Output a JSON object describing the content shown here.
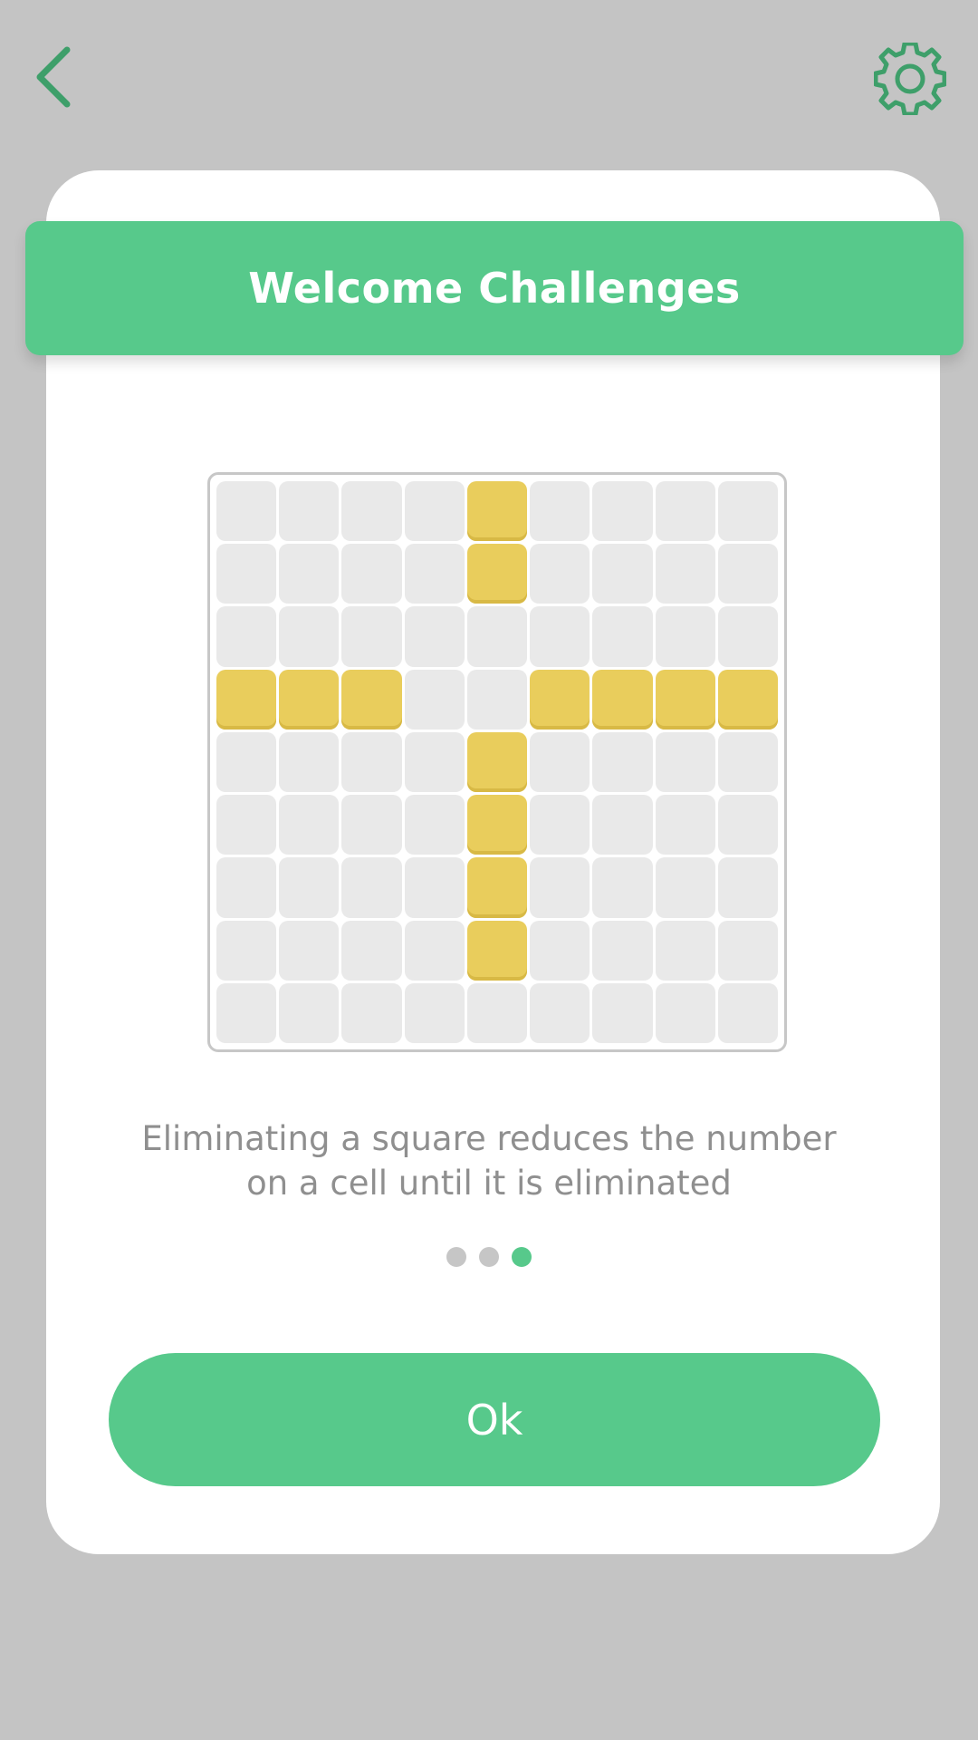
{
  "header": {
    "back_icon": "chevron-left-icon",
    "settings_icon": "gear-icon"
  },
  "dialog": {
    "title": "Welcome Challenges",
    "description_lines": [
      "Eliminating a square reduces the number",
      "on a cell until it is eliminated"
    ],
    "ok_label": "Ok",
    "pagination": {
      "total": 3,
      "active": 3
    }
  },
  "board": {
    "rows": 9,
    "cols": 9,
    "filled_cells": [
      [
        0,
        4
      ],
      [
        1,
        4
      ],
      [
        3,
        0
      ],
      [
        3,
        1
      ],
      [
        3,
        2
      ],
      [
        3,
        5
      ],
      [
        3,
        6
      ],
      [
        3,
        7
      ],
      [
        3,
        8
      ],
      [
        4,
        4
      ],
      [
        5,
        4
      ],
      [
        6,
        4
      ],
      [
        7,
        4
      ]
    ]
  },
  "colors": {
    "accent": "#57c98b",
    "icon": "#3e9f6a",
    "filled_cell": "#e9cd5c",
    "empty_cell": "#e9e9e9",
    "background": "#c4c4c4"
  }
}
